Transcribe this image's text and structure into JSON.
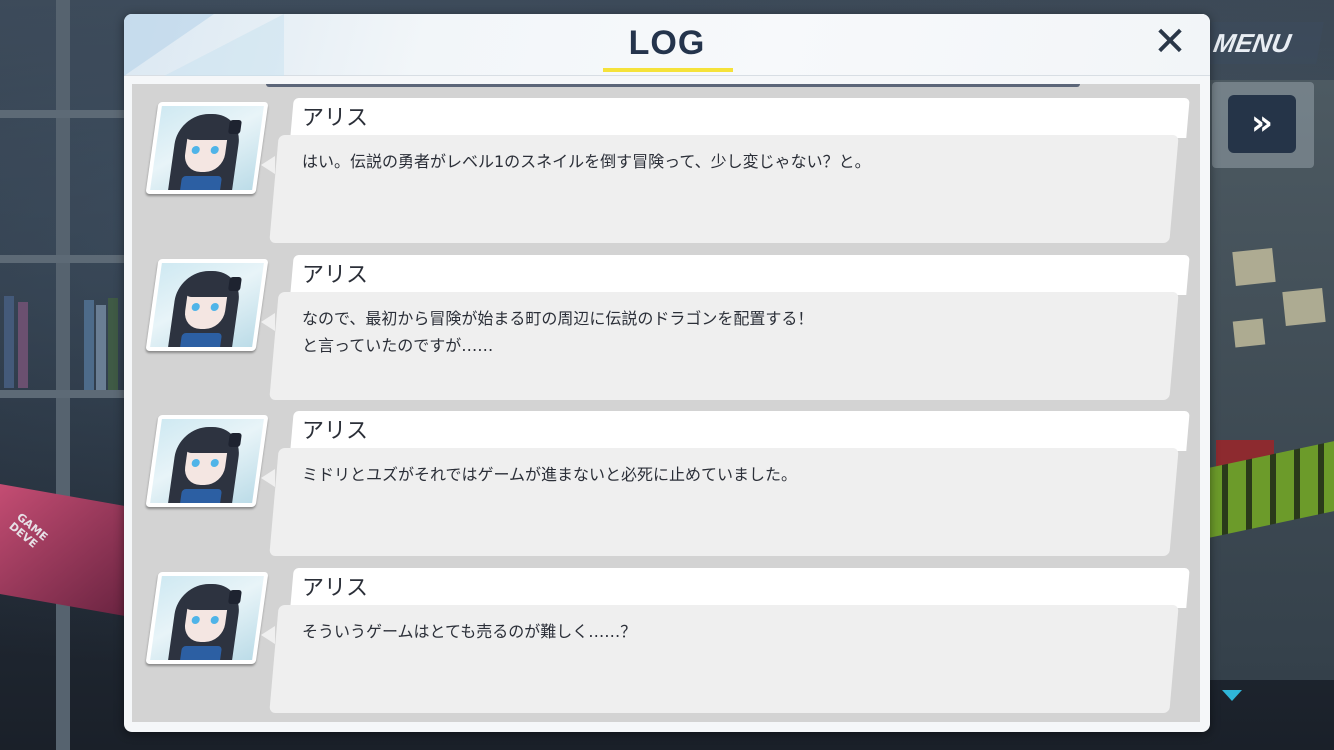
{
  "hud": {
    "menu_label": "MENU",
    "fast_forward_symbol": "»"
  },
  "background": {
    "book_cover_text": "GAME\nDEVE"
  },
  "log": {
    "title": "LOG",
    "close_symbol": "✕",
    "entries": [
      {
        "speaker": "アリス",
        "message": "はい。伝説の勇者がレベル1のスネイルを倒す冒険って、少し変じゃない？と。"
      },
      {
        "speaker": "アリス",
        "message": "なので、最初から冒険が始まる町の周辺に伝説のドラゴンを配置する！\nと言っていたのですが……"
      },
      {
        "speaker": "アリス",
        "message": "ミドリとユズがそれではゲームが進まないと必死に止めていました。"
      },
      {
        "speaker": "アリス",
        "message": "そういうゲームはとても売るのが難しく……？"
      }
    ]
  },
  "colors": {
    "title_underline": "#f5e23a",
    "title_text": "#24344c",
    "scroll_arrow": "#2fb6d9"
  }
}
